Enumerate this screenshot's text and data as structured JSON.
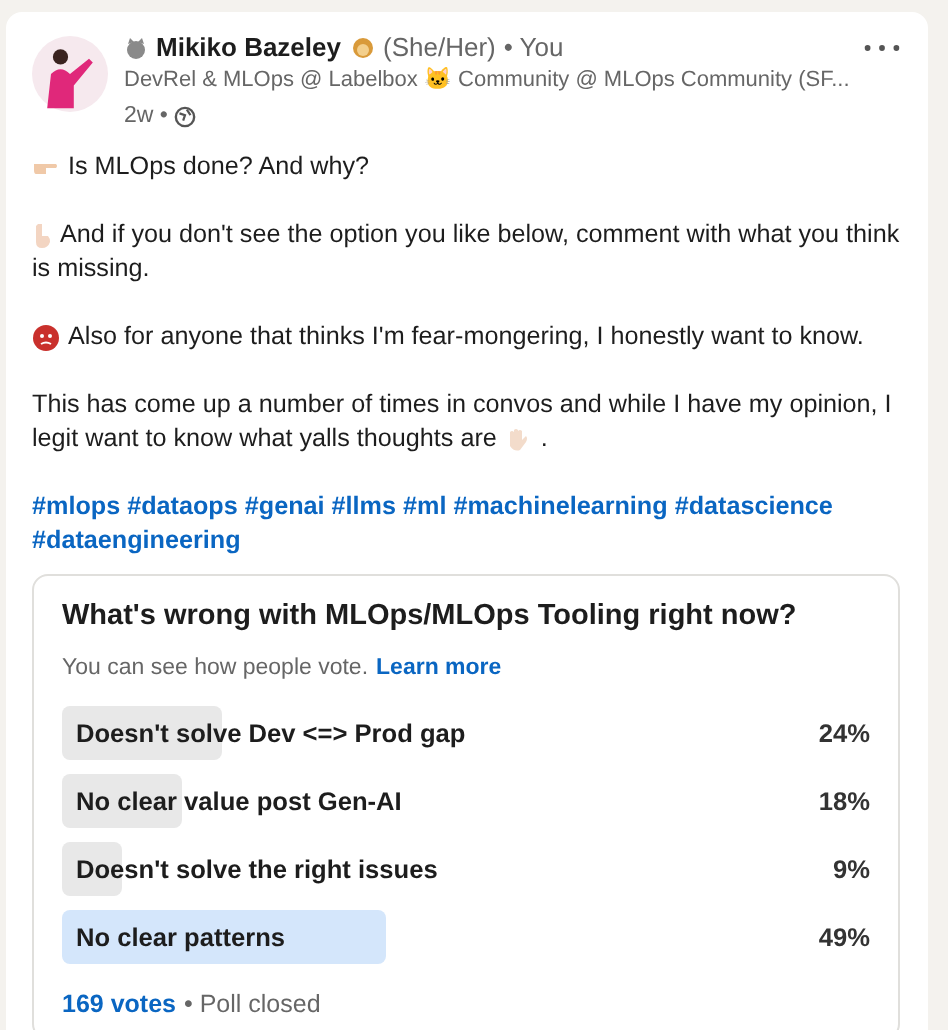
{
  "post": {
    "author": "Mikiko Bazeley",
    "pronouns": "(She/Her)",
    "relation": "• You",
    "headline": "DevRel & MLOps @ Labelbox 🐱 Community @ MLOps Community (SF...",
    "age": "2w •",
    "paragraphs": [
      {
        "lines": [
          "Is MLOps done? And why?"
        ]
      },
      {
        "lines": [
          "And if you don't see the option you like below, comment with what you think",
          "is missing."
        ]
      },
      {
        "lines": [
          "Also for anyone that thinks I'm fear-mongering, I honestly want to know."
        ]
      },
      {
        "lines": [
          "This has come up a number of times in convos and while I have my opinion, I",
          "legit want to know what yalls thoughts are"
        ],
        "after": "."
      }
    ],
    "hashtags": [
      "#mlops",
      "#dataops",
      "#genai",
      "#llms",
      "#ml",
      "#machinelearning",
      "#datascience",
      "#dataengineering"
    ]
  },
  "poll": {
    "question": "What's wrong with MLOps/MLOps Tooling right now?",
    "note": "You can see how people vote.",
    "note_link": "Learn more",
    "options": [
      {
        "label": "Doesn't solve Dev <=> Prod gap",
        "percent": "24%",
        "selected": false
      },
      {
        "label": "No clear value post Gen-AI",
        "percent": "18%",
        "selected": false
      },
      {
        "label": "Doesn't solve the right issues",
        "percent": "9%",
        "selected": false
      },
      {
        "label": "No clear patterns",
        "percent": "49%",
        "selected": true
      }
    ],
    "votes": "169 votes",
    "status": "• Poll closed"
  }
}
